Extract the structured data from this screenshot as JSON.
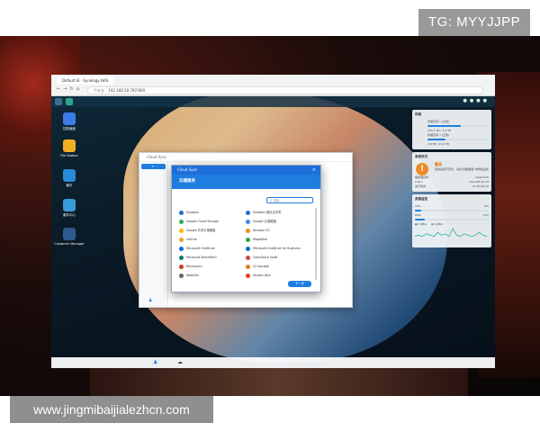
{
  "watermarks": {
    "tg": "TG: MYYJJPP",
    "site": "www.jingmibaijialezhcn.com"
  },
  "browser": {
    "tab_title": "Default IE · Synology NAS",
    "address": "192.168.50.797/000",
    "lock_label": "不安全"
  },
  "desktop_icons": [
    {
      "label": "控制面板",
      "color": "#3d7ce6"
    },
    {
      "label": "File Station",
      "color": "#f2b020"
    },
    {
      "label": "套件",
      "color": "#2a8ad8"
    },
    {
      "label": "套件中心",
      "color": "#3a9bd8"
    },
    {
      "label": "Customer Manager",
      "color": "#2e5a8e"
    }
  ],
  "window": {
    "title": "Cloud Sync",
    "footer_icon": "user-icon"
  },
  "dialog": {
    "title": "Cloud Sync",
    "subtitle": "云端服务",
    "search_placeholder": "搜索",
    "next_label": "下一步",
    "services": [
      {
        "left": "Dropbox",
        "right": "Dropbox 团队文件夹",
        "lc": "#1e6fd9",
        "rc": "#1e6fd9"
      },
      {
        "left": "Google Cloud Storage",
        "right": "Google 云端硬盘",
        "lc": "#34a853",
        "rc": "#4285f4"
      },
      {
        "left": "Google 共享云端硬盘",
        "right": "Amazon S3",
        "lc": "#fbbc04",
        "rc": "#f29111"
      },
      {
        "left": "hiDrive",
        "right": "MegaDisk",
        "lc": "#f0a020",
        "rc": "#2aa84a"
      },
      {
        "left": "Microsoft OneDrive",
        "right": "Microsoft OneDrive for Business",
        "lc": "#0a6ad8",
        "rc": "#0a6ad8"
      },
      {
        "left": "Microsoft SharePoint",
        "right": "OpenStack Swift",
        "lc": "#0a7a6e",
        "rc": "#d04a3a"
      },
      {
        "left": "Rackspace",
        "right": "S3 storage",
        "lc": "#c43a2a",
        "rc": "#e08020"
      },
      {
        "left": "WebDAV",
        "right": "Yandex Disk",
        "lc": "#666666",
        "rc": "#e03a2a"
      }
    ]
  },
  "widgets": {
    "storage": {
      "title": "存储",
      "vol1_name": "存储空间 1 (正常)",
      "vol1_size": "225.7 TB / 1.0 TB",
      "vol1_fill": 0.55,
      "vol2_name": "存储空间 2 (正常)",
      "vol2_size": "2.6 TB / 10.0 TB",
      "vol2_fill": 0.3
    },
    "health": {
      "title": "系统状况",
      "warn_title": "警告",
      "warn_text": "您的设置不安全，请在\"控制面板\"中修改设置",
      "rows": [
        {
          "k": "服务器名称",
          "v": "Default IE"
        },
        {
          "k": "LAN 1",
          "v": "192.168.50.79"
        },
        {
          "k": "运行时间",
          "v": "21:35:06:00"
        }
      ]
    },
    "resource": {
      "title": "资源监控",
      "cpu_label": "CPU",
      "cpu_value": "8%",
      "cpu_fill": 0.08,
      "ram_label": "RAM",
      "ram_value": "13%",
      "ram_fill": 0.13,
      "legend_upload": "0 KB/s",
      "legend_download": "0 KB/s",
      "spark": [
        3,
        4,
        3,
        5,
        4,
        3,
        6,
        4,
        5,
        3,
        9,
        4,
        3,
        5,
        4,
        3,
        4,
        6,
        4,
        3
      ]
    }
  }
}
